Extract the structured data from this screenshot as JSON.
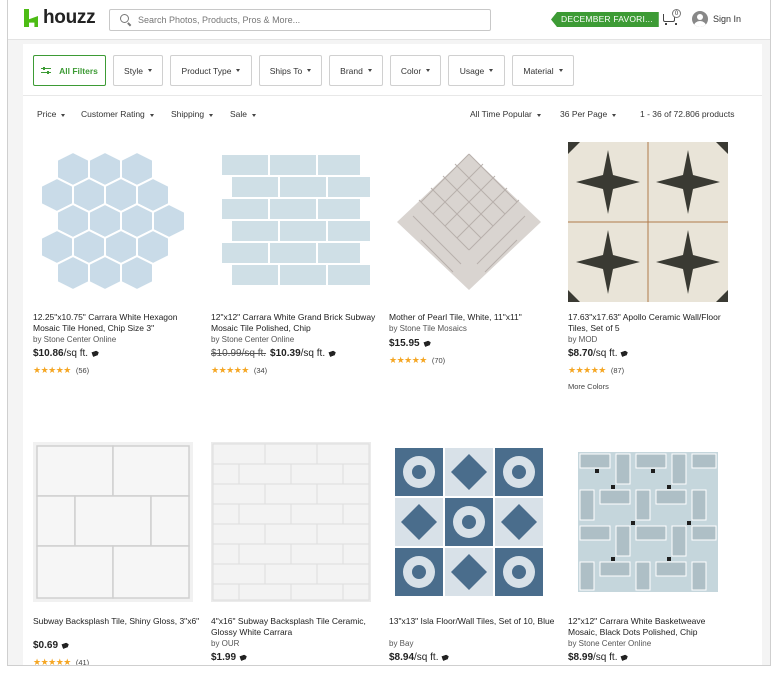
{
  "header": {
    "logo": "houzz",
    "search_placeholder": "Search Photos, Products, Pros & More...",
    "promo": "DECEMBER FAVORI...",
    "cart_count": "0",
    "signin": "Sign In"
  },
  "filters": {
    "all_filters": "All Filters",
    "buttons": [
      "Style",
      "Product Type",
      "Ships To",
      "Brand",
      "Color",
      "Usage",
      "Material"
    ]
  },
  "sort": {
    "left": [
      "Price",
      "Customer Rating",
      "Shipping",
      "Sale"
    ],
    "order": "All Time Popular",
    "per_page": "36 Per Page",
    "count": "1 - 36 of 72.806 products"
  },
  "products": [
    {
      "title": "12.25\"x10.75\" Carrara White Hexagon Mosaic Tile Honed, Chip Size 3\"",
      "by": "by Stone Center Online",
      "price": "$10.86",
      "unit": "/sq ft.",
      "stars": "★★★★★",
      "rating": 4.5,
      "reviews": "(56)"
    },
    {
      "title": "12\"x12\" Carrara White Grand Brick Subway Mosaic Tile Polished, Chip",
      "by": "by Stone Center Online",
      "old_price": "$10.99/sq ft.",
      "price": "$10.39",
      "unit": "/sq ft.",
      "stars": "★★★★★",
      "rating": 5,
      "reviews": "(34)"
    },
    {
      "title": "Mother of Pearl Tile, White, 11\"x11\"",
      "by": "by Stone Tile Mosaics",
      "price": "$15.95",
      "unit": "",
      "stars": "★★★★★",
      "rating": 4.5,
      "reviews": "(70)"
    },
    {
      "title": "17.63\"x17.63\" Apollo Ceramic Wall/Floor Tiles, Set of 5",
      "by": "by MOD",
      "price": "$8.70",
      "unit": "/sq ft.",
      "stars": "★★★★★",
      "rating": 4.5,
      "reviews": "(87)",
      "more": "More Colors"
    },
    {
      "title": "Subway Backsplash Tile, Shiny Gloss, 3\"x6\"",
      "by": "",
      "price": "$0.69",
      "unit": "",
      "stars": "★★★★★",
      "rating": 4.5,
      "reviews": "(41)"
    },
    {
      "title": "4\"x16\" Subway Backsplash Tile Ceramic, Glossy White Carrara",
      "by": "by OUR",
      "price": "$1.99",
      "unit": ""
    },
    {
      "title": "13\"x13\" Isla Floor/Wall Tiles, Set of 10, Blue",
      "by": "by Bay",
      "price": "$8.94",
      "unit": "/sq ft."
    },
    {
      "title": "12\"x12\" Carrara White Basketweave Mosaic, Black Dots Polished, Chip",
      "by": "by Stone Center Online",
      "price": "$8.99",
      "unit": "/sq ft."
    }
  ],
  "colors": {
    "brand_green": "#3d9b35",
    "star": "#f5a623"
  }
}
